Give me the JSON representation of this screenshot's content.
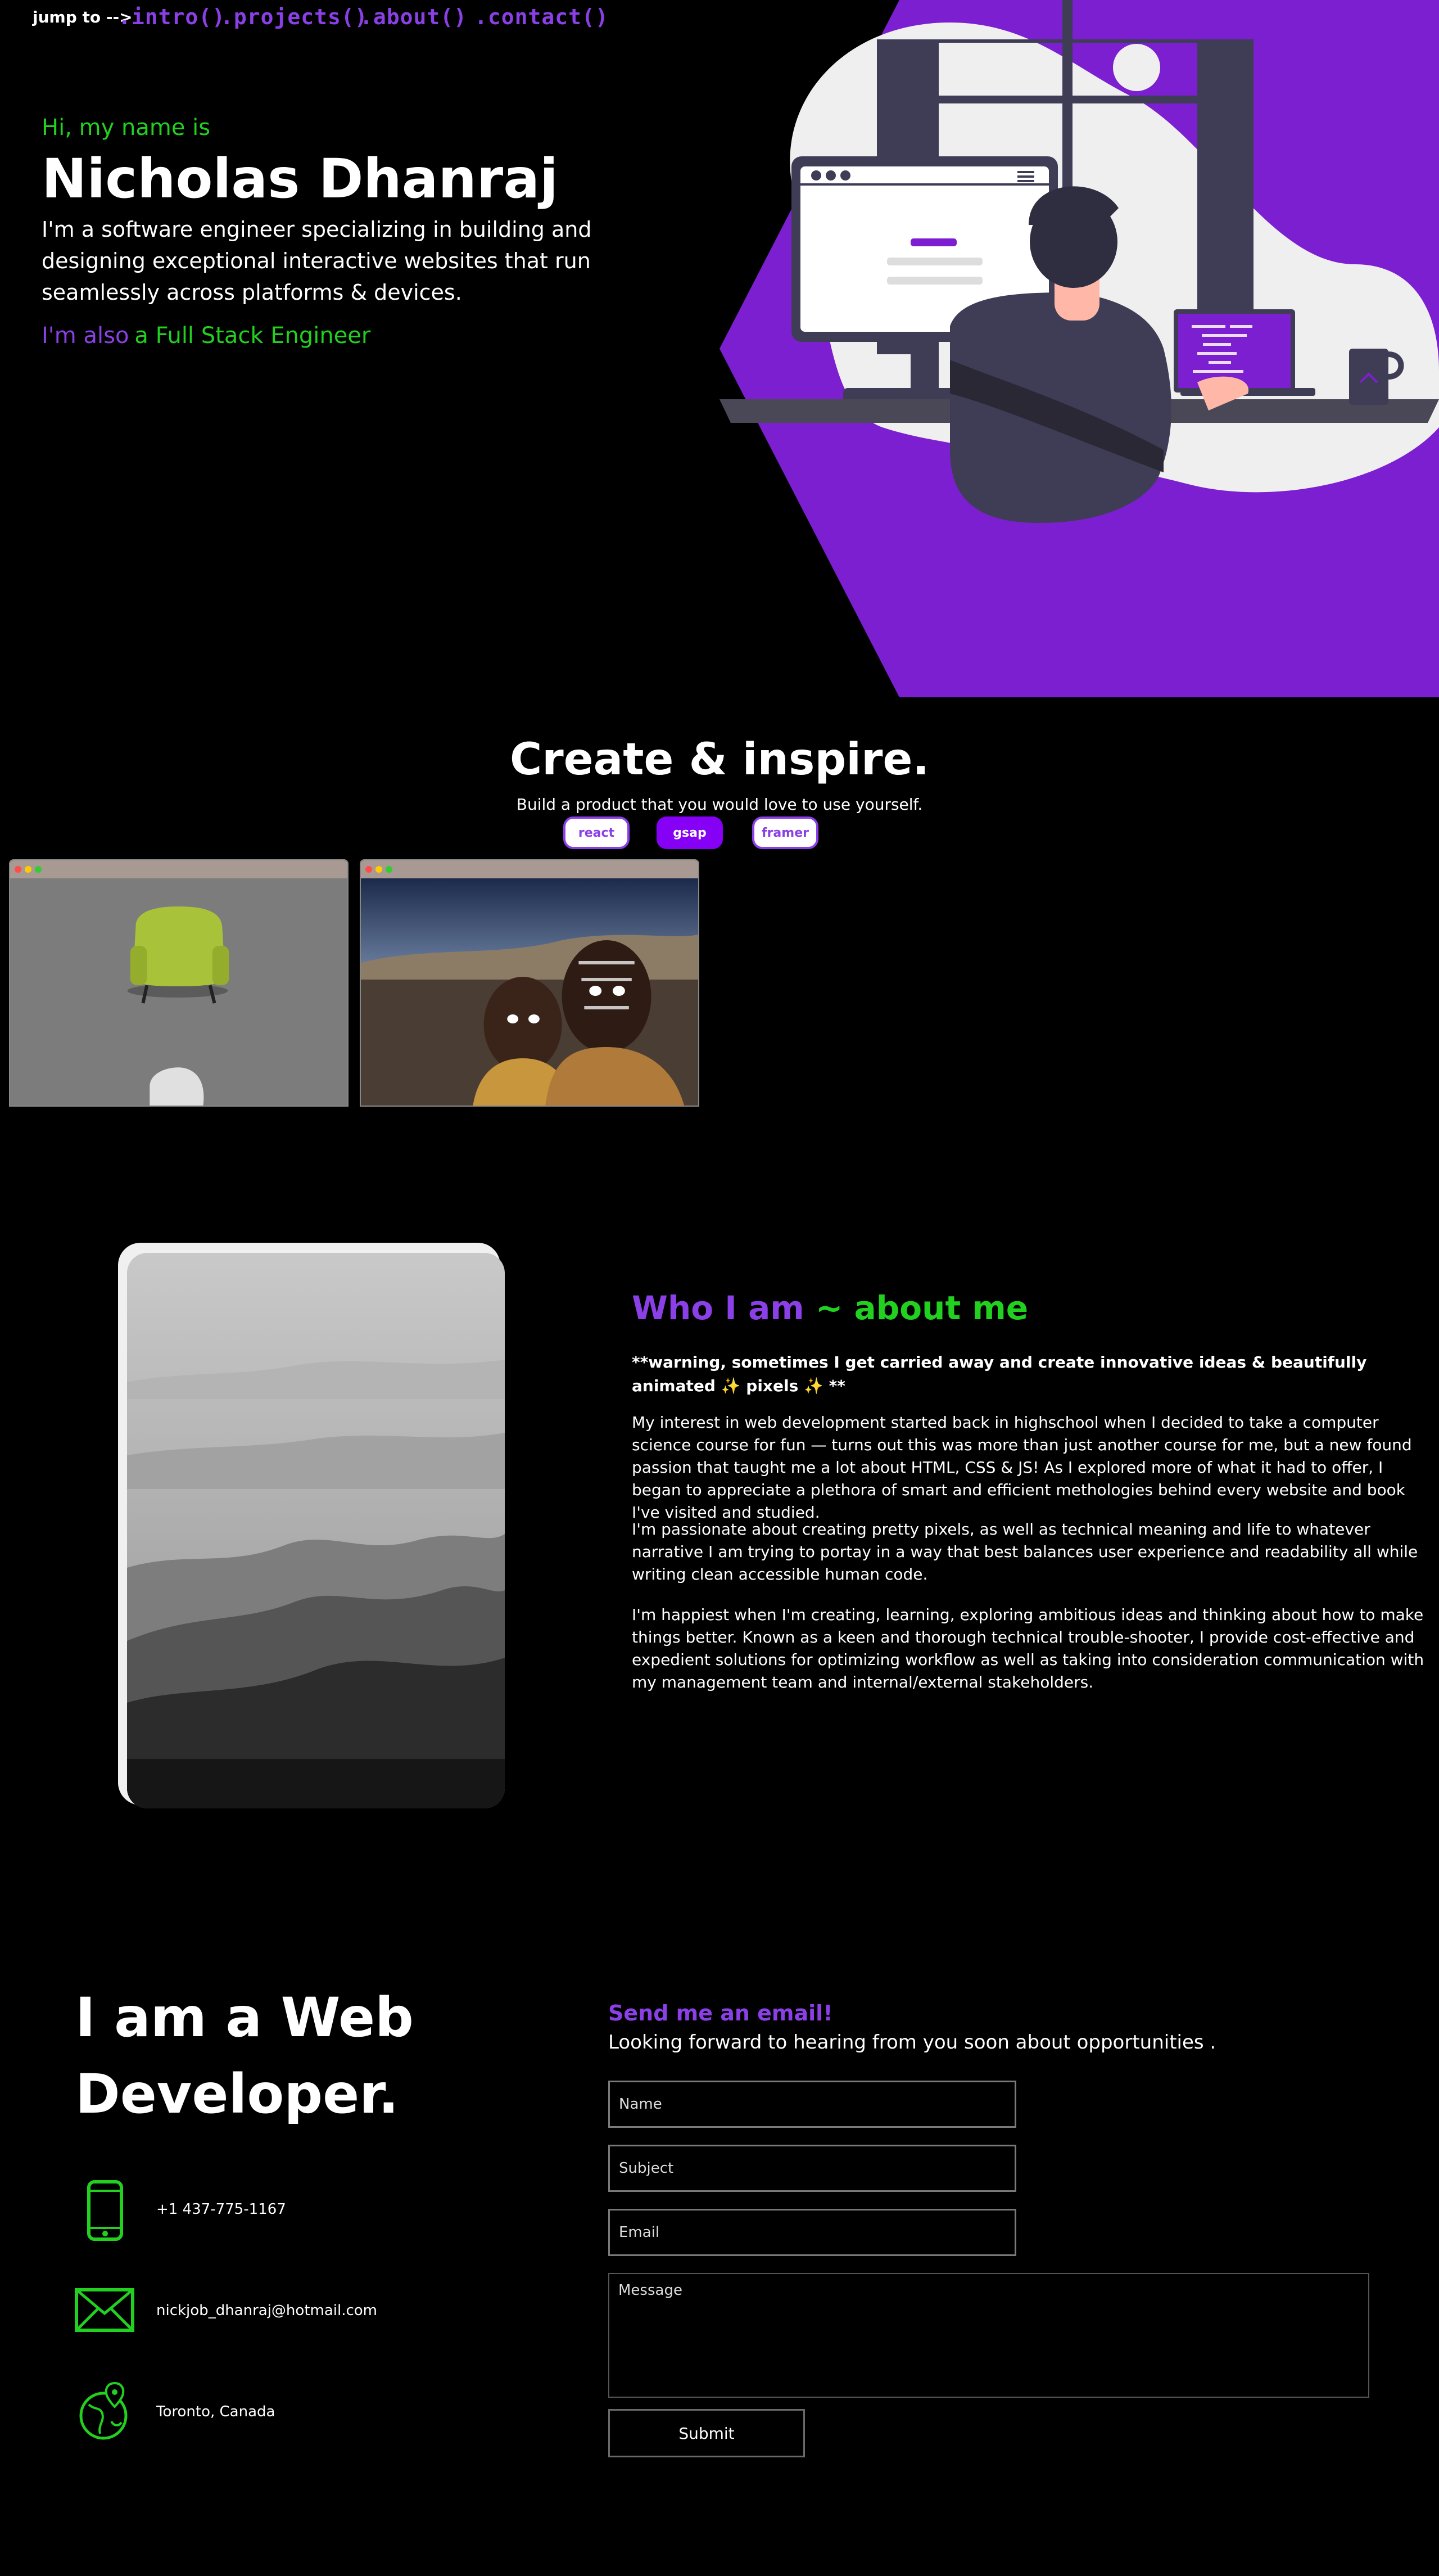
{
  "nav": {
    "jump_label": "jump to -->",
    "links": [
      ".intro()",
      ".projects()",
      ".about()",
      ".contact()"
    ],
    "theme_toggle_icon": "moon-icon"
  },
  "hero": {
    "greeting": "Hi, my name is",
    "name": "Nicholas Dhanraj",
    "description": "I'm a software engineer specializing in building and designing exceptional interactive websites that run seamlessly across platforms & devices.",
    "also_prefix": "I'm also",
    "also_role": "a Full Stack Engineer",
    "illustration_icon": "developer-at-desk-illustration"
  },
  "projects": {
    "title": "Create & inspire.",
    "subtitle": "Build a product that you would love to use yourself.",
    "filters": [
      "react",
      "gsap",
      "framer"
    ],
    "active_filter": "gsap",
    "cards": [
      {
        "image": "green-armchair-photo"
      },
      {
        "image": "face-painted-kids-photo"
      }
    ]
  },
  "about": {
    "title_a": "Who I am",
    "title_b": "~ about me",
    "warning": "**warning, sometimes I get carried away and create innovative ideas & beautifully animated ✨ pixels ✨ **",
    "paragraphs": [
      "My interest in web development started back in highschool when I decided to take a computer science course for fun — turns out this was more than just another course for me, but a new found passion that taught me a lot about HTML, CSS & JS! As I explored more of what it had to offer, I began to appreciate a plethora of smart and efficient methologies behind every website and book I've visited and studied.",
      "I'm passionate about creating pretty pixels, as well as technical meaning and life to whatever narrative I am trying to portay in a way that best balances user experience and readability all while writing clean accessible human code.",
      "I'm happiest when I'm creating, learning, exploring ambitious ideas and thinking about how to make things better. Known as a keen and thorough technical trouble-shooter, I provide cost-effective and expedient solutions for optimizing workflow as well as taking into consideration communication with my management team and internal/external stakeholders."
    ],
    "image": "misty-mountains-photo"
  },
  "contact": {
    "title_line1": "I am a Web",
    "title_line2": "Developer.",
    "phone": "+1 437-775-1167",
    "email": "nickjob_dhanraj@hotmail.com",
    "location": "Toronto, Canada",
    "form_title": "Send me an email!",
    "form_subtitle": "Looking forward to hearing from you soon about opportunities .",
    "placeholders": {
      "name": "Name",
      "subject": "Subject",
      "email": "Email",
      "message": "Message"
    },
    "submit_label": "Submit"
  },
  "colors": {
    "accent_purple": "#8b3fe6",
    "accent_green": "#22d11f",
    "hero_purple": "#7b1fd1"
  }
}
